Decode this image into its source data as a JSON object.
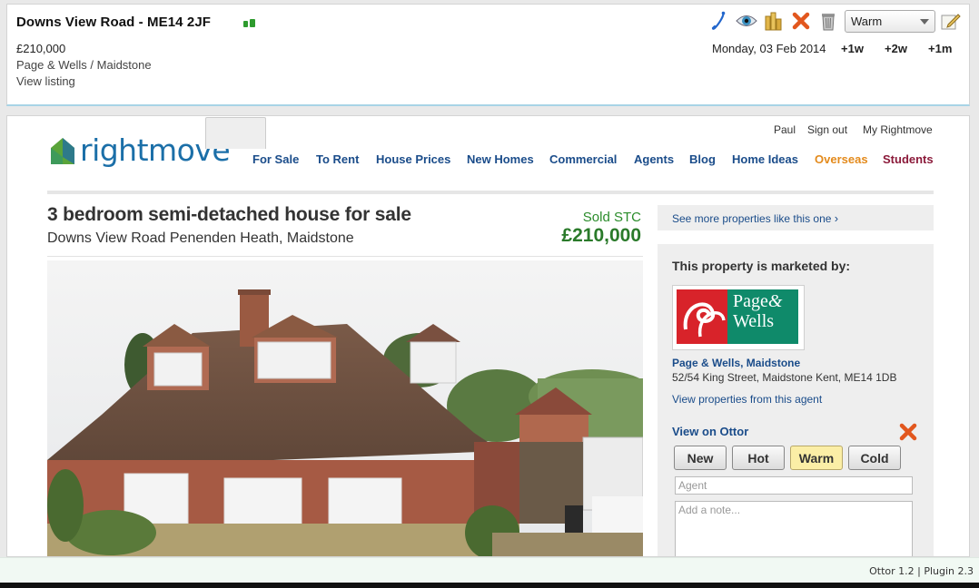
{
  "ottor": {
    "title": "Downs View Road - ME14 2JF",
    "price": "£210,000",
    "agent": "Page & Wells / Maidstone",
    "view_listing": "View listing",
    "status_select": "Warm",
    "date": "Monday, 03 Feb 2014",
    "plus_1w": "+1w",
    "plus_2w": "+2w",
    "plus_1m": "+1m",
    "icons": [
      "phone-icon",
      "eye-icon",
      "coins-icon",
      "delete-x-icon",
      "trash-icon",
      "edit-note-icon"
    ]
  },
  "rightmove": {
    "logo_text": "rightmove",
    "top_links": {
      "user": "Paul",
      "signout": "Sign out",
      "my": "My Rightmove"
    },
    "nav": {
      "for_sale": "For Sale",
      "to_rent": "To Rent",
      "house_prices": "House Prices",
      "new_homes": "New Homes",
      "commercial": "Commercial",
      "agents": "Agents",
      "blog": "Blog",
      "home_ideas": "Home Ideas",
      "overseas": "Overseas",
      "students": "Students"
    },
    "colors": {
      "brand_blue": "#1b6fa8",
      "overseas": "#e38a1c",
      "students": "#8b1a3a",
      "price_green": "#2a7a2a"
    },
    "listing": {
      "title": "3 bedroom semi-detached house for sale",
      "address": "Downs View Road Penenden Heath, Maidstone",
      "status": "Sold STC",
      "price": "£210,000"
    },
    "see_more": "See more properties like this one",
    "agent_box": {
      "heading": "This property is marketed by:",
      "logo_line1": "Page",
      "logo_amp": "&",
      "logo_line2": "Wells",
      "name": "Page & Wells, Maidstone",
      "address": "52/54 King Street, Maidstone Kent, ME14 1DB",
      "view_props": "View properties from this agent"
    },
    "ottor_widget": {
      "heading": "View on Ottor",
      "buttons": [
        "New",
        "Hot",
        "Warm",
        "Cold"
      ],
      "active": "Warm",
      "agent_placeholder": "Agent",
      "note_placeholder": "Add a note..."
    }
  },
  "footer": {
    "text": "Ottor 1.2 | Plugin 2.3"
  }
}
